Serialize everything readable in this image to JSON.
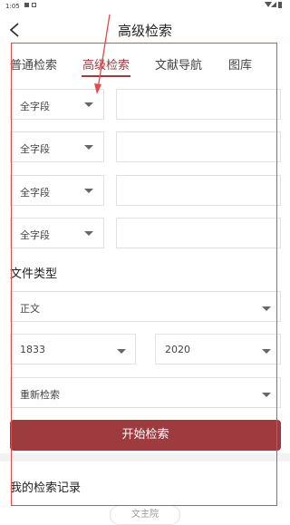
{
  "status_bar": {
    "time": "1:05"
  },
  "header": {
    "title": "高级检索"
  },
  "tabs": [
    {
      "label": "普通检索"
    },
    {
      "label": "高级检索"
    },
    {
      "label": "文献导航"
    },
    {
      "label": "图库"
    }
  ],
  "fields": [
    {
      "select": "全字段",
      "value": ""
    },
    {
      "select": "全字段",
      "value": ""
    },
    {
      "select": "全字段",
      "value": ""
    },
    {
      "select": "全字段",
      "value": ""
    }
  ],
  "file_type": {
    "label": "文件类型",
    "type_select": "正文",
    "year_from": "1833",
    "year_to": "2020",
    "search_scope": "重新检索"
  },
  "start_button": "开始检索",
  "history": {
    "label": "我的检索记录",
    "chip": "文主院"
  },
  "colors": {
    "accent": "#9d3b3f",
    "annotation": "#e44a4a"
  }
}
